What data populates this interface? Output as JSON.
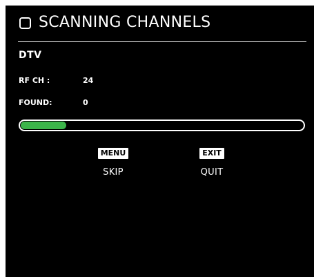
{
  "dialog": {
    "icon": "square-outline-icon",
    "title": "SCANNING CHANNELS"
  },
  "section": {
    "label": "DTV"
  },
  "info": {
    "rf_channel": {
      "label": "RF CH :",
      "value": "24"
    },
    "found": {
      "label": "FOUND:",
      "value": "0"
    }
  },
  "progress": {
    "fraction": 0.16,
    "fill_color": "#3cb54a"
  },
  "actions": {
    "menu": {
      "key": "MENU",
      "label": "SKIP"
    },
    "exit": {
      "key": "EXIT",
      "label": "QUIT"
    }
  }
}
